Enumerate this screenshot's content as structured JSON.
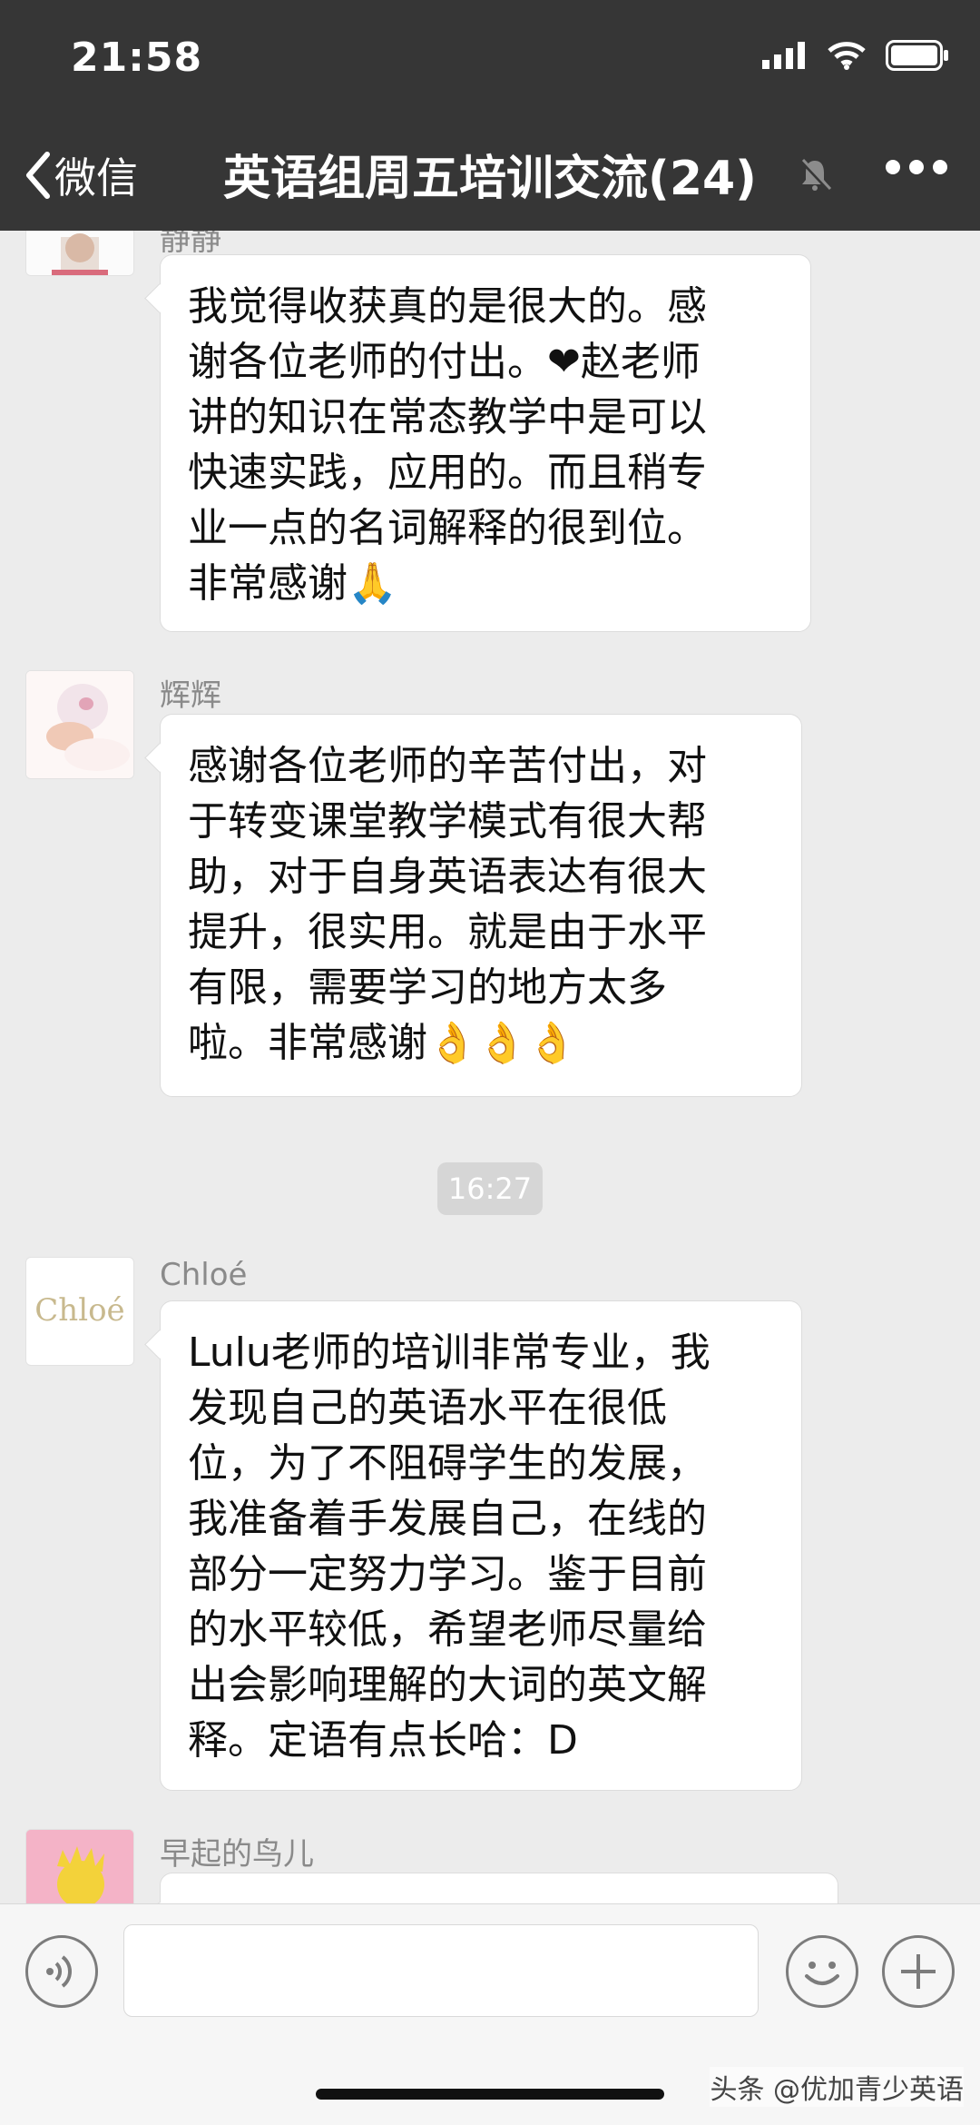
{
  "status_bar": {
    "time": "21:58"
  },
  "header": {
    "back_label": "微信",
    "title": "英语组周五培训交流(24)"
  },
  "messages": [
    {
      "sender": "静静",
      "lines": [
        "我觉得收获真的是很大的。感",
        "谢各位老师的付出。❤赵老师",
        "讲的知识在常态教学中是可以",
        "快速实践，应用的。而且稍专",
        "业一点的名词解释的很到位。",
        "非常感谢🙏"
      ]
    },
    {
      "sender": "辉辉",
      "lines": [
        "感谢各位老师的辛苦付出，对",
        "于转变课堂教学模式有很大帮",
        "助，对于自身英语表达有很大",
        "提升，很实用。就是由于水平",
        "有限，需要学习的地方太多",
        "啦。非常感谢👌👌👌"
      ]
    },
    {
      "sender": "Chloé",
      "avatar_text": "Chloé",
      "lines": [
        "Lulu老师的培训非常专业，我",
        "发现自己的英语水平在很低",
        "位，为了不阻碍学生的发展，",
        "我准备着手发展自己，在线的",
        "部分一定努力学习。鉴于目前",
        "的水平较低，希望老师尽量给",
        "出会影响理解的大词的英文解",
        "释。定语有点长哈：D"
      ]
    },
    {
      "sender": "早起的鸟儿",
      "lines": []
    }
  ],
  "timestamp": "16:27",
  "watermark": "头条 @优加青少英语",
  "icons": [
    "back-chevron-icon",
    "mute-bell-icon",
    "more-dots-icon",
    "voice-icon",
    "emoji-icon",
    "add-icon",
    "signal-icon",
    "wifi-icon",
    "battery-icon"
  ]
}
